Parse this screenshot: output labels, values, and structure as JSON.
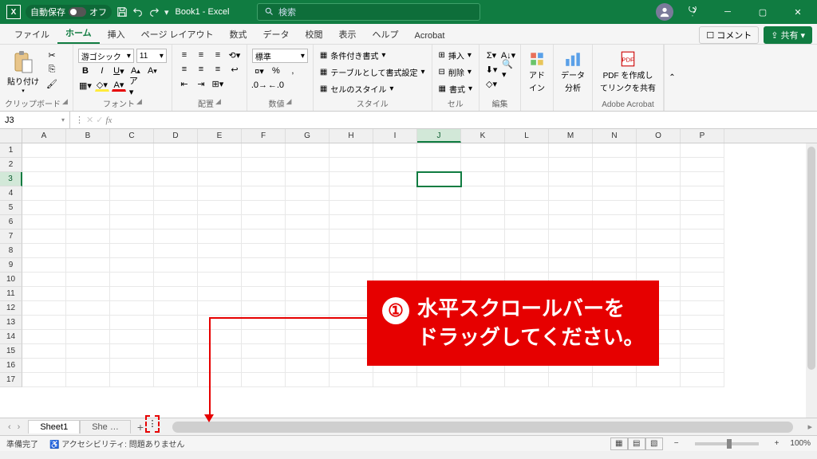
{
  "titlebar": {
    "autosave_label": "自動保存",
    "autosave_state": "オフ",
    "title": "Book1 - Excel",
    "search_placeholder": "検索"
  },
  "tabs": {
    "file": "ファイル",
    "home": "ホーム",
    "insert": "挿入",
    "page_layout": "ページ レイアウト",
    "formulas": "数式",
    "data": "データ",
    "review": "校閲",
    "view": "表示",
    "help": "ヘルプ",
    "acrobat": "Acrobat",
    "comments": "コメント",
    "share": "共有"
  },
  "ribbon": {
    "clipboard": {
      "paste": "貼り付け",
      "label": "クリップボード"
    },
    "font": {
      "name": "游ゴシック",
      "size": "11",
      "label": "フォント"
    },
    "align": {
      "label": "配置"
    },
    "number": {
      "format": "標準",
      "label": "数値"
    },
    "styles": {
      "cond": "条件付き書式",
      "table": "テーブルとして書式設定",
      "cell": "セルのスタイル",
      "label": "スタイル"
    },
    "cells": {
      "insert": "挿入",
      "delete": "削除",
      "format": "書式",
      "label": "セル"
    },
    "editing": {
      "label": "編集"
    },
    "addins": {
      "top": "アド",
      "bottom": "イン"
    },
    "analysis": {
      "top": "データ",
      "bottom": "分析"
    },
    "acrobat": {
      "line1": "PDF を作成し",
      "line2": "てリンクを共有",
      "label": "Adobe Acrobat"
    }
  },
  "namebox": {
    "value": "J3"
  },
  "columns": [
    "A",
    "B",
    "C",
    "D",
    "E",
    "F",
    "G",
    "H",
    "I",
    "J",
    "K",
    "L",
    "M",
    "N",
    "O",
    "P"
  ],
  "rows": [
    "1",
    "2",
    "3",
    "4",
    "5",
    "6",
    "7",
    "8",
    "9",
    "10",
    "11",
    "12",
    "13",
    "14",
    "15",
    "16",
    "17"
  ],
  "active": {
    "col": "J",
    "row": "3"
  },
  "sheets": {
    "s1": "Sheet1",
    "s2": "She",
    "ellipsis": "…"
  },
  "status": {
    "ready": "準備完了",
    "accessibility": "アクセシビリティ: 問題ありません",
    "zoom": "100%"
  },
  "annotation": {
    "num": "①",
    "line1": "水平スクロールバーを",
    "line2": "ドラッグしてください。"
  }
}
